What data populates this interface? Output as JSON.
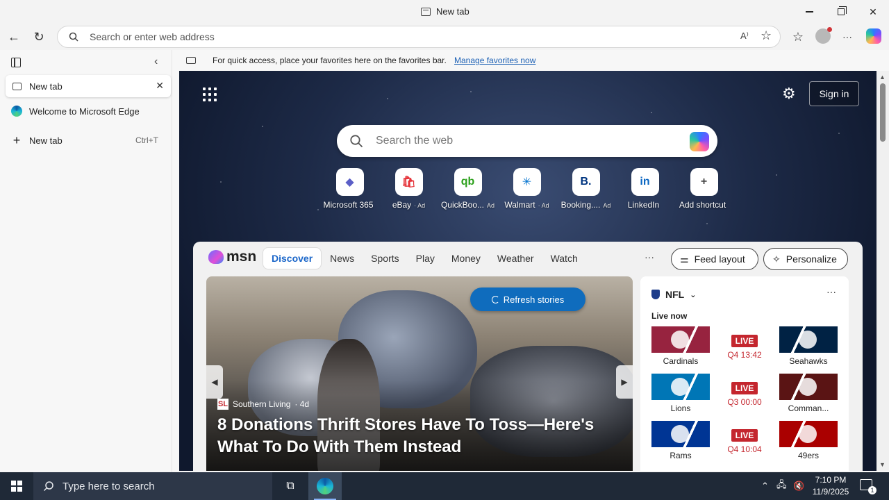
{
  "window": {
    "title": "New tab"
  },
  "toolbar": {
    "address_placeholder": "Search or enter web address"
  },
  "sidebar": {
    "tabs": [
      {
        "label": "New tab",
        "active": true
      },
      {
        "label": "Welcome to Microsoft Edge",
        "active": false
      }
    ],
    "new_tab": {
      "label": "New tab",
      "shortcut": "Ctrl+T"
    }
  },
  "favbar": {
    "message": "For quick access, place your favorites here on the favorites bar.",
    "link": "Manage favorites now"
  },
  "newtab": {
    "signin": "Sign in",
    "search_placeholder": "Search the web",
    "shortcuts": [
      {
        "label": "Microsoft 365",
        "ad": "",
        "icon": "microsoft365-icon",
        "color": "#5b5fc7",
        "glyph": "◆"
      },
      {
        "label": "eBay",
        "ad": "· Ad",
        "icon": "ebay-icon",
        "color": "#e53238",
        "glyph": "🛍"
      },
      {
        "label": "QuickBoo...",
        "ad": "Ad",
        "icon": "quickbooks-icon",
        "color": "#2ca01c",
        "glyph": "qb"
      },
      {
        "label": "Walmart",
        "ad": "· Ad",
        "icon": "walmart-icon",
        "color": "#0071ce",
        "glyph": "✳"
      },
      {
        "label": "Booking....",
        "ad": "Ad",
        "icon": "booking-icon",
        "color": "#003580",
        "glyph": "B."
      },
      {
        "label": "LinkedIn",
        "ad": "",
        "icon": "linkedin-icon",
        "color": "#0a66c2",
        "glyph": "in"
      },
      {
        "label": "Add shortcut",
        "ad": "",
        "icon": "plus-icon",
        "color": "#444444",
        "glyph": "+"
      }
    ]
  },
  "msn": {
    "logo": "msn",
    "nav": [
      {
        "label": "Discover",
        "active": true
      },
      {
        "label": "News",
        "active": false
      },
      {
        "label": "Sports",
        "active": false
      },
      {
        "label": "Play",
        "active": false
      },
      {
        "label": "Money",
        "active": false
      },
      {
        "label": "Weather",
        "active": false
      },
      {
        "label": "Watch",
        "active": false
      }
    ],
    "more": "···",
    "feed_layout": "Feed layout",
    "personalize": "Personalize",
    "refresh": "Refresh stories",
    "story": {
      "source": "Southern Living",
      "age": "· 4d",
      "headline": "8 Donations Thrift Stores Have To Toss—Here's What To Do With Them Instead"
    },
    "nfl": {
      "title": "NFL",
      "live_now": "Live now",
      "games": [
        {
          "home": "Cardinals",
          "away": "Seahawks",
          "status": "LIVE",
          "clock": "Q4 13:42",
          "home_color": "#97233f",
          "away_color": "#002244"
        },
        {
          "home": "Lions",
          "away": "Comman...",
          "status": "LIVE",
          "clock": "Q3 00:00",
          "home_color": "#0076b6",
          "away_color": "#5a1414"
        },
        {
          "home": "Rams",
          "away": "49ers",
          "status": "LIVE",
          "clock": "Q4 10:04",
          "home_color": "#003594",
          "away_color": "#aa0000"
        }
      ]
    }
  },
  "taskbar": {
    "search_placeholder": "Type here to search",
    "time": "7:10 PM",
    "date": "11/9/2025",
    "notifications": "1"
  }
}
